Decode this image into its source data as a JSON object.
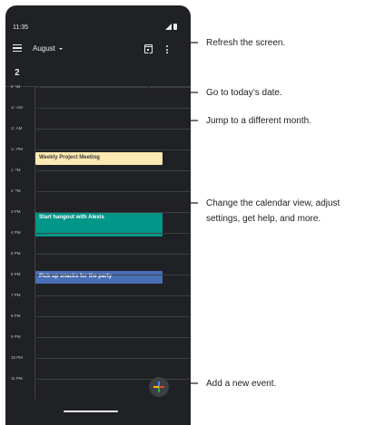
{
  "status_bar": {
    "time": "11:35"
  },
  "app_bar": {
    "month": "August"
  },
  "day_header": {
    "day_number": "2"
  },
  "hours": [
    "9 AM",
    "10 AM",
    "11 AM",
    "12 PM",
    "1 PM",
    "2 PM",
    "3 PM",
    "4 PM",
    "5 PM",
    "6 PM",
    "7 PM",
    "8 PM",
    "9 PM",
    "10 PM",
    "11 PM"
  ],
  "events": [
    {
      "title": "Weekly Project Meeting",
      "color": "#fce8b2"
    },
    {
      "title": "Start hangout with Alexis",
      "color": "#009688"
    },
    {
      "title": "Pick up snacks for the party",
      "color": "#4a6fb6"
    }
  ],
  "callouts": {
    "refresh": "Refresh the screen.",
    "today": "Go to today’s date.",
    "month": "Jump to a different month.",
    "menu_line1": "Change the calendar view, adjust",
    "menu_line2": "settings, get help, and more.",
    "add": "Add a new event."
  },
  "fab_colors": [
    "#4285f4",
    "#ea4335",
    "#fbbc05",
    "#34a853"
  ]
}
